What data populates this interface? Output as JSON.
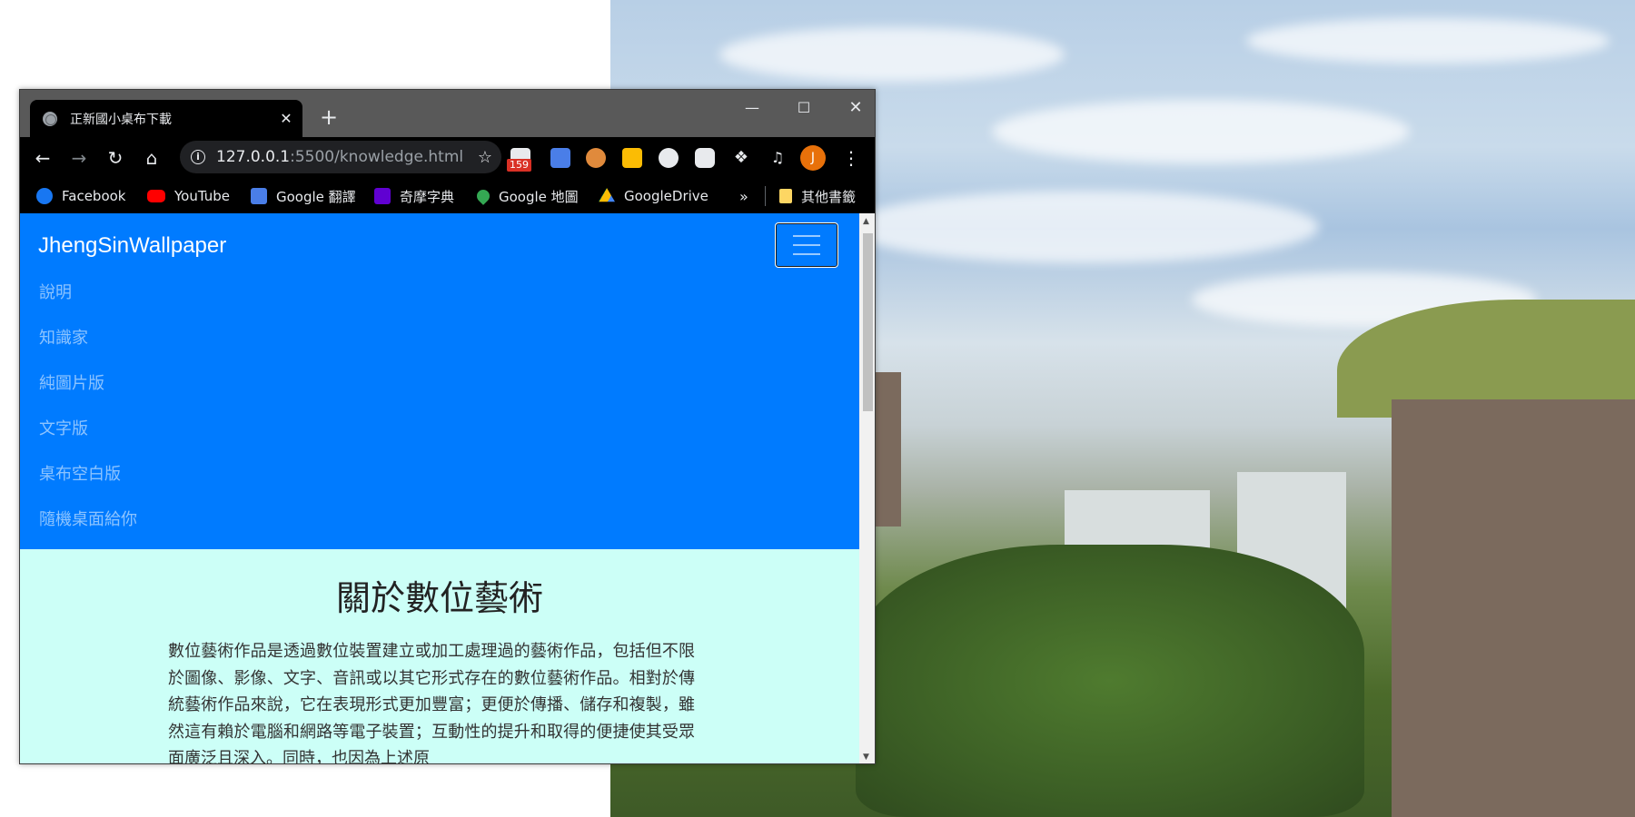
{
  "browser": {
    "tab_title": "正新國小桌布下載",
    "new_tab": "+",
    "url_host": "127.0.0.1",
    "url_path": ":5500/knowledge.html",
    "gmail_badge": "159",
    "profile_initial": "J"
  },
  "bookmarks": [
    {
      "label": "Facebook",
      "icon": "facebook-icon"
    },
    {
      "label": "YouTube",
      "icon": "youtube-icon"
    },
    {
      "label": "Google 翻譯",
      "icon": "google-translate-icon"
    },
    {
      "label": "奇摩字典",
      "icon": "yahoo-dictionary-icon"
    },
    {
      "label": "Google 地圖",
      "icon": "google-maps-icon"
    },
    {
      "label": "GoogleDrive",
      "icon": "google-drive-icon"
    }
  ],
  "bookmarks_more": "»",
  "bookmarks_other": "其他書籤",
  "page": {
    "brand": "JhengSinWallpaper",
    "nav": [
      "說明",
      "知識家",
      "純圖片版",
      "文字版",
      "桌布空白版",
      "隨機桌面給你"
    ],
    "title": "關於數位藝術",
    "body": "數位藝術作品是透過數位裝置建立或加工處理過的藝術作品，包括但不限於圖像、影像、文字、音訊或以其它形式存在的數位藝術作品。相對於傳統藝術作品來說，它在表現形式更加豐富；更便於傳播、儲存和複製，雖然這有賴於電腦和網路等電子裝置；互動性的提升和取得的便捷使其受眾面廣泛且深入。同時，也因為上述原"
  },
  "colors": {
    "navbar": "#007bff",
    "content_bg": "#ccfff7",
    "browser_chrome": "#000000"
  }
}
